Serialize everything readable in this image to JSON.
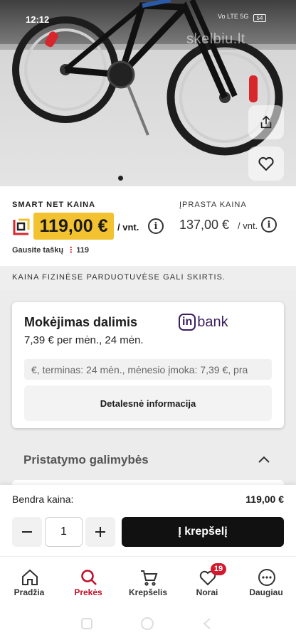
{
  "status_bar": {
    "time": "12:12",
    "network": "Vo LTE 5G",
    "battery": "54"
  },
  "hero": {
    "watermark": "skelbiu.lt",
    "share_icon": "share-icon",
    "wishlist_icon": "heart-icon"
  },
  "price": {
    "smart_label": "SMART NET KAINA",
    "smart_value": "119,00 €",
    "smart_unit": "/ vnt.",
    "regular_label": "ĮPRASTA KAINA",
    "regular_value": "137,00 €",
    "regular_unit": "/ vnt.",
    "points_prefix": "Gausite taškų",
    "points_value": "119",
    "info_glyph": "i"
  },
  "notice": "KAINA FIZINĖSE PARDUOTUVĖSE GALI SKIRTIS.",
  "installment": {
    "title": "Mokėjimas dalimis",
    "subtitle": "7,39 € per mėn., 24 mėn.",
    "provider_in": "in",
    "provider_bank": "bank",
    "scrolling_text": "€, terminas: 24 mėn., mėnesio įmoka: 7,39 €, pra",
    "details_button": "Detalesnė informacija"
  },
  "delivery": {
    "title": "Pristatymo galimybės"
  },
  "buybar": {
    "total_label": "Bendra kaina:",
    "total_value": "119,00 €",
    "quantity": "1",
    "add_to_cart": "Į krepšelį"
  },
  "nav": {
    "items": [
      {
        "label": "Pradžia",
        "icon": "home-icon"
      },
      {
        "label": "Prekės",
        "icon": "search-icon"
      },
      {
        "label": "Krepšelis",
        "icon": "cart-icon"
      },
      {
        "label": "Norai",
        "icon": "heart-icon",
        "badge": "19"
      },
      {
        "label": "Daugiau",
        "icon": "more-icon"
      }
    ],
    "active": "Prekės"
  },
  "colors": {
    "accent": "#c0102a",
    "price_highlight": "#f2c230",
    "badge": "#d2192f",
    "provider": "#3b1f5e"
  }
}
